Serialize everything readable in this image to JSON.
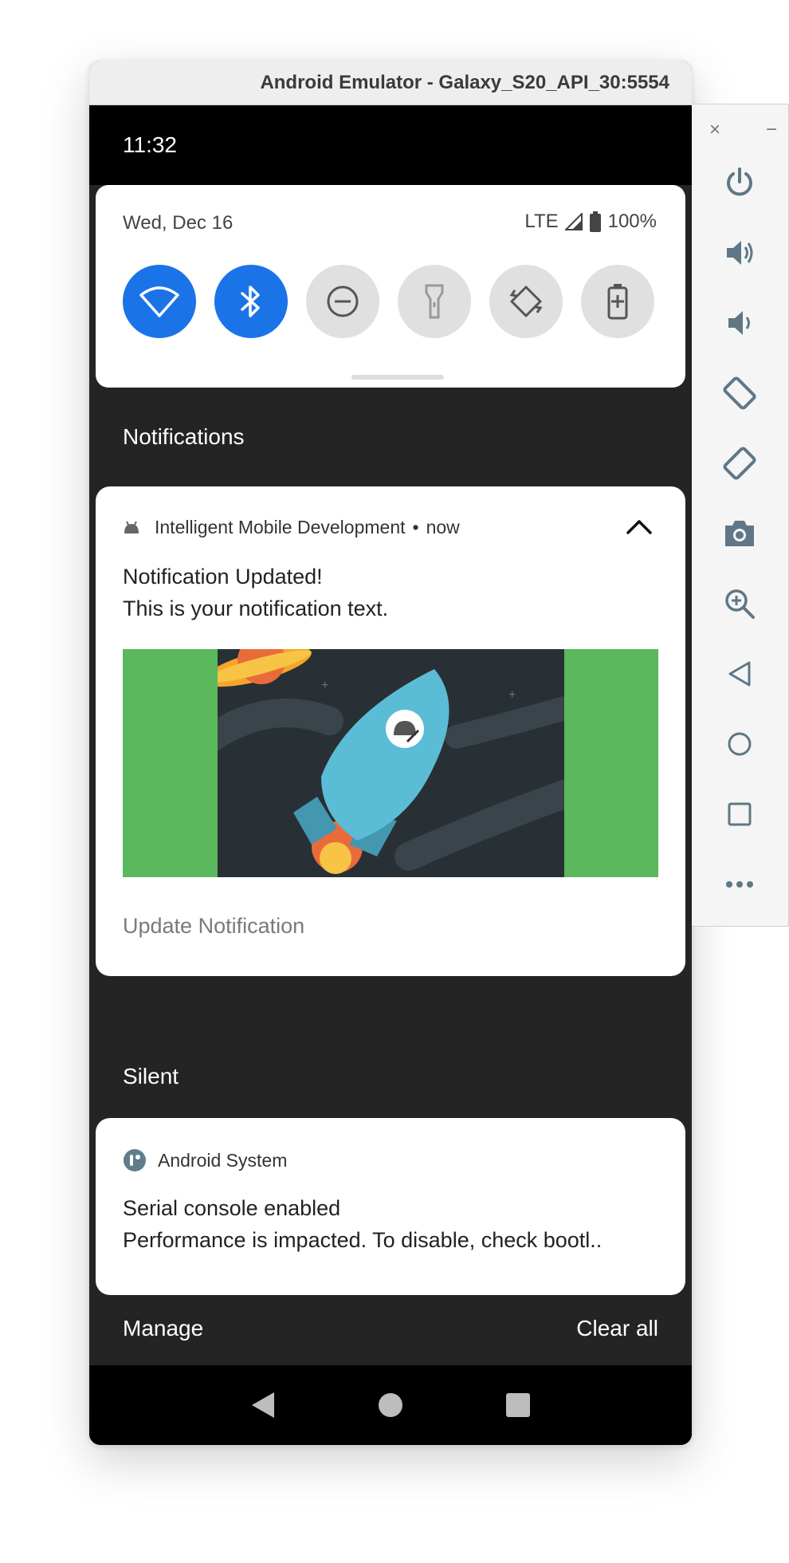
{
  "window": {
    "title": "Android Emulator - Galaxy_S20_API_30:5554"
  },
  "status_bar": {
    "time": "11:32"
  },
  "quick_settings": {
    "date": "Wed, Dec 16",
    "network": "LTE",
    "battery": "100%",
    "tiles": [
      {
        "icon": "wifi-icon",
        "state": "on"
      },
      {
        "icon": "bluetooth-icon",
        "state": "on"
      },
      {
        "icon": "do-not-disturb-icon",
        "state": "off"
      },
      {
        "icon": "flashlight-icon",
        "state": "off"
      },
      {
        "icon": "auto-rotate-icon",
        "state": "off"
      },
      {
        "icon": "battery-saver-icon",
        "state": "off"
      }
    ]
  },
  "sections": {
    "notifications": "Notifications",
    "silent": "Silent"
  },
  "notification_1": {
    "app": "Intelligent Mobile Development",
    "separator": "•",
    "time": "now",
    "title": "Notification Updated!",
    "text": "This is your notification text.",
    "action": "Update Notification",
    "colors": {
      "banner_bg": "#5cb85c",
      "art_bg": "#283035",
      "rocket": "#5bbcd6"
    }
  },
  "notification_2": {
    "app": "Android System",
    "title": "Serial console enabled",
    "text": "Performance is impacted. To disable, check bootl.."
  },
  "footer": {
    "manage": "Manage",
    "clear_all": "Clear all"
  },
  "side_panel": {
    "close": "×",
    "minimize": "−",
    "buttons": [
      "power-icon",
      "volume-up-icon",
      "volume-down-icon",
      "rotate-left-icon",
      "rotate-right-icon",
      "camera-icon",
      "zoom-icon",
      "back-icon",
      "home-icon",
      "overview-icon",
      "more-icon"
    ]
  },
  "accent": "#1b73e8"
}
